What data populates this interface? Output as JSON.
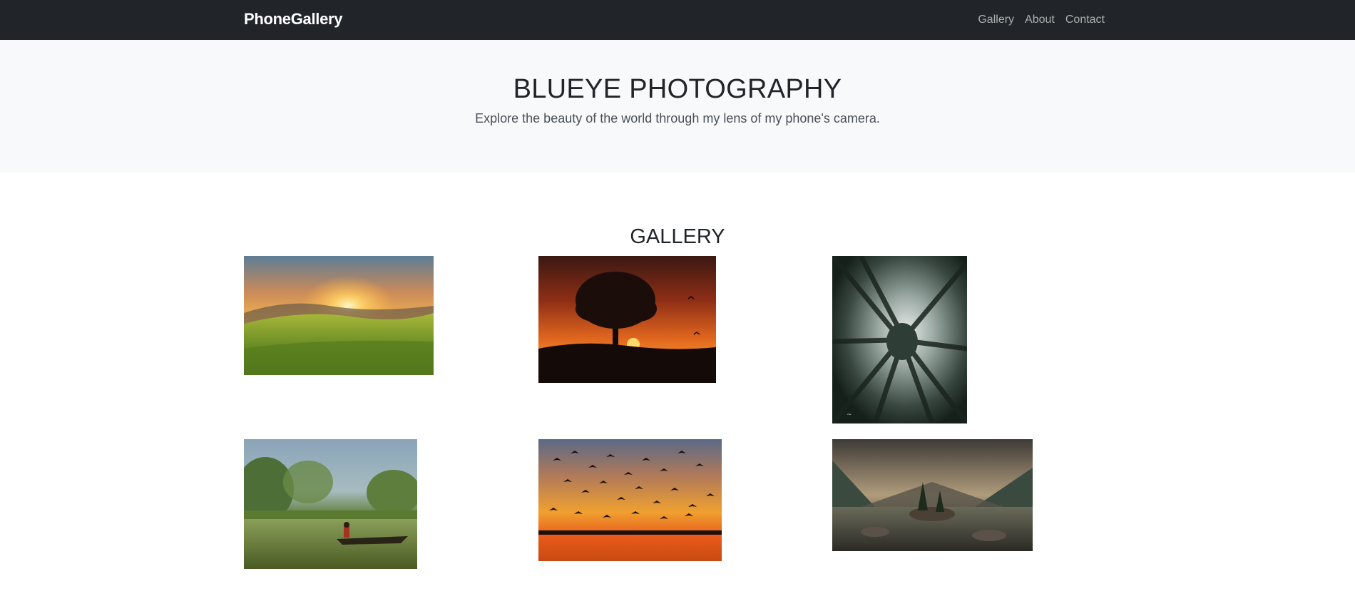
{
  "navbar": {
    "brand": "PhoneGallery",
    "links": [
      "Gallery",
      "About",
      "Contact"
    ]
  },
  "hero": {
    "title": "BLUEYE PHOTOGRAPHY",
    "subtitle": "Explore the beauty of the world through my lens of my phone's camera."
  },
  "gallery": {
    "title": "GALLERY",
    "photos": [
      {
        "subject": "grassy hillside sunset"
      },
      {
        "subject": "lone tree silhouette at sunset with birds"
      },
      {
        "subject": "looking up at tall pine forest"
      },
      {
        "subject": "person in canoe on misty jungle river"
      },
      {
        "subject": "flock of birds over orange sunset lake"
      },
      {
        "subject": "mountain lake with rock island and trees"
      }
    ]
  }
}
